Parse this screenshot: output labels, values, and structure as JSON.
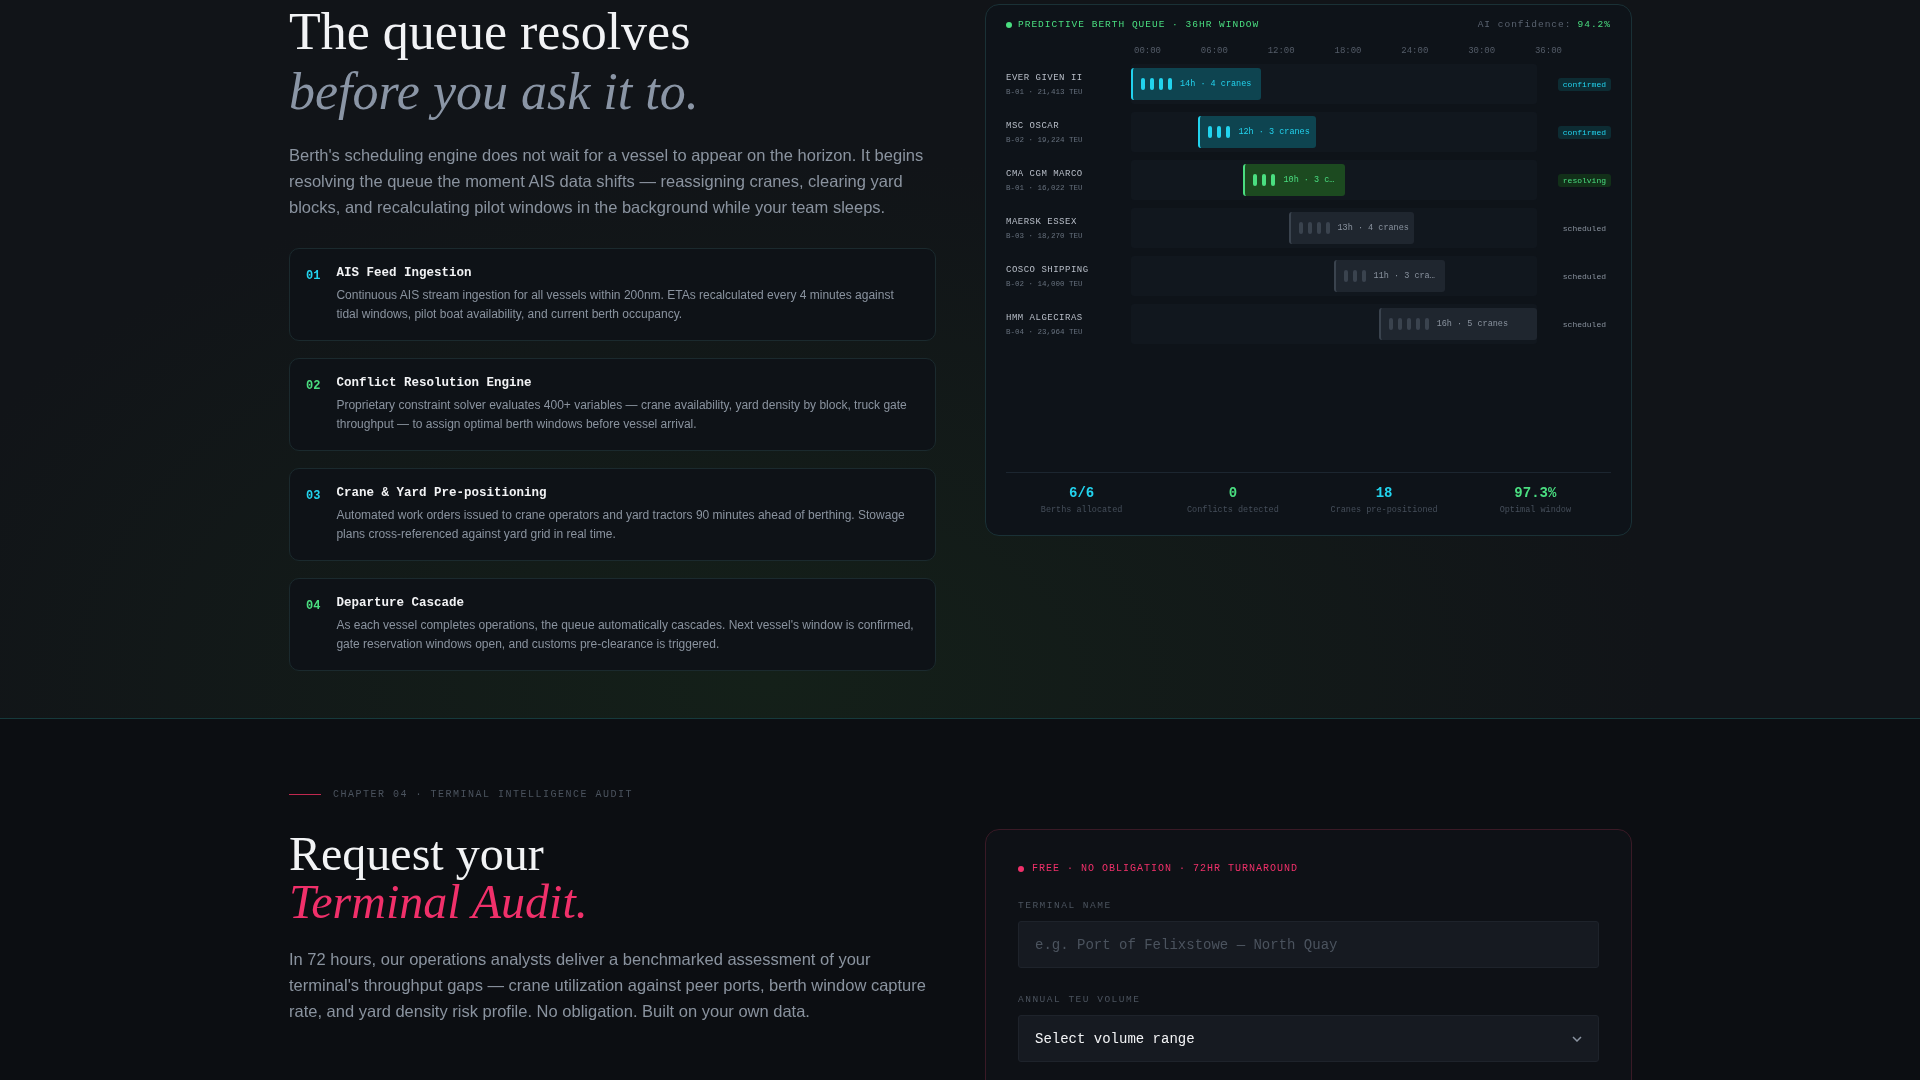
{
  "hero": {
    "title_line": "The queue resolves",
    "title_accent": "before you ask it to.",
    "intro": "Berth's scheduling engine does not wait for a vessel to appear on the horizon. It begins resolving the queue the moment AIS data shifts — reassigning cranes, clearing yard blocks, and recalculating pilot windows in the background while your team sleeps."
  },
  "steps": [
    {
      "number": "01",
      "title": "AIS Feed Ingestion",
      "text": "Continuous AIS stream ingestion for all vessels within 200nm. ETAs recalculated every 4 minutes against tidal windows, pilot boat availability, and current berth occupancy."
    },
    {
      "number": "02",
      "title": "Conflict Resolution Engine",
      "text": "Proprietary constraint solver evaluates 400+ variables — crane availability, yard density by block, truck gate throughput — to assign optimal berth windows before vessel arrival."
    },
    {
      "number": "03",
      "title": "Crane & Yard Pre-positioning",
      "text": "Automated work orders issued to crane operators and yard tractors 90 minutes ahead of berthing. Stowage plans cross-referenced against yard grid in real time."
    },
    {
      "number": "04",
      "title": "Departure Cascade",
      "text": "As each vessel completes operations, the queue automatically cascades. Next vessel's window is confirmed, gate reservation windows open, and customs pre-clearance is triggered."
    }
  ],
  "queue_panel": {
    "title": "PREDICTIVE BERTH QUEUE · 36HR WINDOW",
    "confidence_label": "AI confidence:",
    "confidence_value": "94.2%",
    "time_axis": [
      "00:00",
      "06:00",
      "12:00",
      "18:00",
      "24:00",
      "30:00",
      "36:00"
    ],
    "vessels": [
      {
        "name": "EVER GIVEN II",
        "detail": "B-01 · 21,413 TEU",
        "bar_label": "14h · 4 cranes",
        "status": "confirmed",
        "kind": "confirmed"
      },
      {
        "name": "MSC OSCAR",
        "detail": "B-02 · 19,224 TEU",
        "bar_label": "12h · 3 cranes",
        "status": "confirmed",
        "kind": "confirmed"
      },
      {
        "name": "CMA CGM MARCO",
        "detail": "B-01 · 16,022 TEU",
        "bar_label": "10h · 3 c…",
        "status": "resolving",
        "kind": "resolving"
      },
      {
        "name": "MAERSK ESSEX",
        "detail": "B-03 · 18,270 TEU",
        "bar_label": "13h · 4 cranes",
        "status": "scheduled",
        "kind": "scheduled"
      },
      {
        "name": "COSCO SHIPPING",
        "detail": "B-02 · 14,000 TEU",
        "bar_label": "11h · 3 cra…",
        "status": "scheduled",
        "kind": "scheduled"
      },
      {
        "name": "HMM ALGECIRAS",
        "detail": "B-04 · 23,964 TEU",
        "bar_label": "16h · 5 cranes",
        "status": "scheduled",
        "kind": "scheduled"
      }
    ],
    "stats": [
      {
        "value": "6/6",
        "label": "Berths allocated",
        "kind": "cyan"
      },
      {
        "value": "0",
        "label": "Conflicts detected",
        "kind": "green"
      },
      {
        "value": "18",
        "label": "Cranes pre-positioned",
        "kind": "cyan"
      },
      {
        "value": "97.3%",
        "label": "Optimal window",
        "kind": "green"
      }
    ]
  },
  "audit": {
    "chapter": "CHAPTER 04 · TERMINAL INTELLIGENCE AUDIT",
    "title_line": "Request your",
    "title_accent": "Terminal Audit.",
    "intro": "In 72 hours, our operations analysts deliver a benchmarked assessment of your terminal's throughput gaps — crane utilization against peer ports, berth window capture rate, and yard density risk profile. No obligation. Built on your own data.",
    "form": {
      "tag": "FREE · NO OBLIGATION · 72HR TURNAROUND",
      "fields": [
        {
          "label": "TERMINAL NAME",
          "kind": "text",
          "placeholder": "e.g. Port of Felixstowe — North Quay"
        },
        {
          "label": "ANNUAL TEU VOLUME",
          "kind": "select",
          "value": "Select volume range"
        }
      ]
    }
  }
}
